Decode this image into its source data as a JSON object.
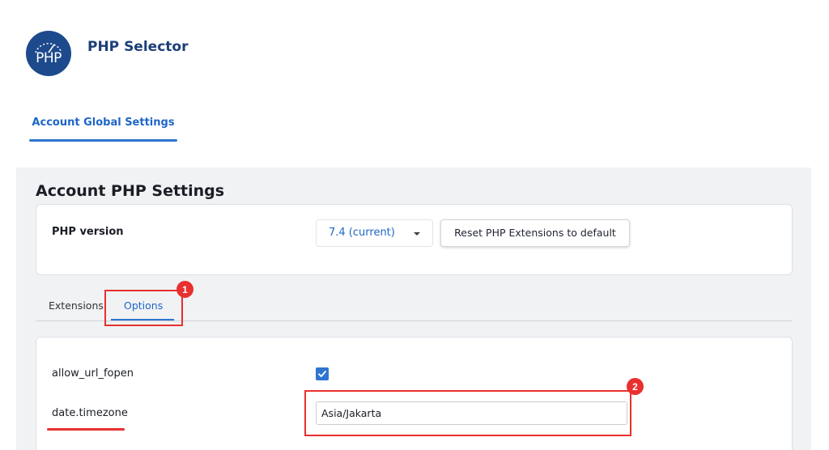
{
  "header": {
    "logo_text": "PHP",
    "title": "PHP Selector"
  },
  "global_tab": {
    "label": "Account Global Settings"
  },
  "section": {
    "title": "Account PHP Settings"
  },
  "php_version": {
    "label": "PHP version",
    "selected": "7.4 (current)",
    "reset_label": "Reset PHP Extensions to default"
  },
  "tabs": [
    {
      "label": "Extensions",
      "active": false
    },
    {
      "label": "Options",
      "active": true
    }
  ],
  "options": {
    "allow_url_fopen": {
      "label": "allow_url_fopen",
      "checked": true
    },
    "date_timezone": {
      "label": "date.timezone",
      "value": "Asia/Jakarta"
    }
  },
  "annotations": {
    "badge1": "1",
    "badge2": "2"
  },
  "colors": {
    "accent": "#2f74d1",
    "brand": "#1d4a8c",
    "annotation": "#e8302e"
  }
}
